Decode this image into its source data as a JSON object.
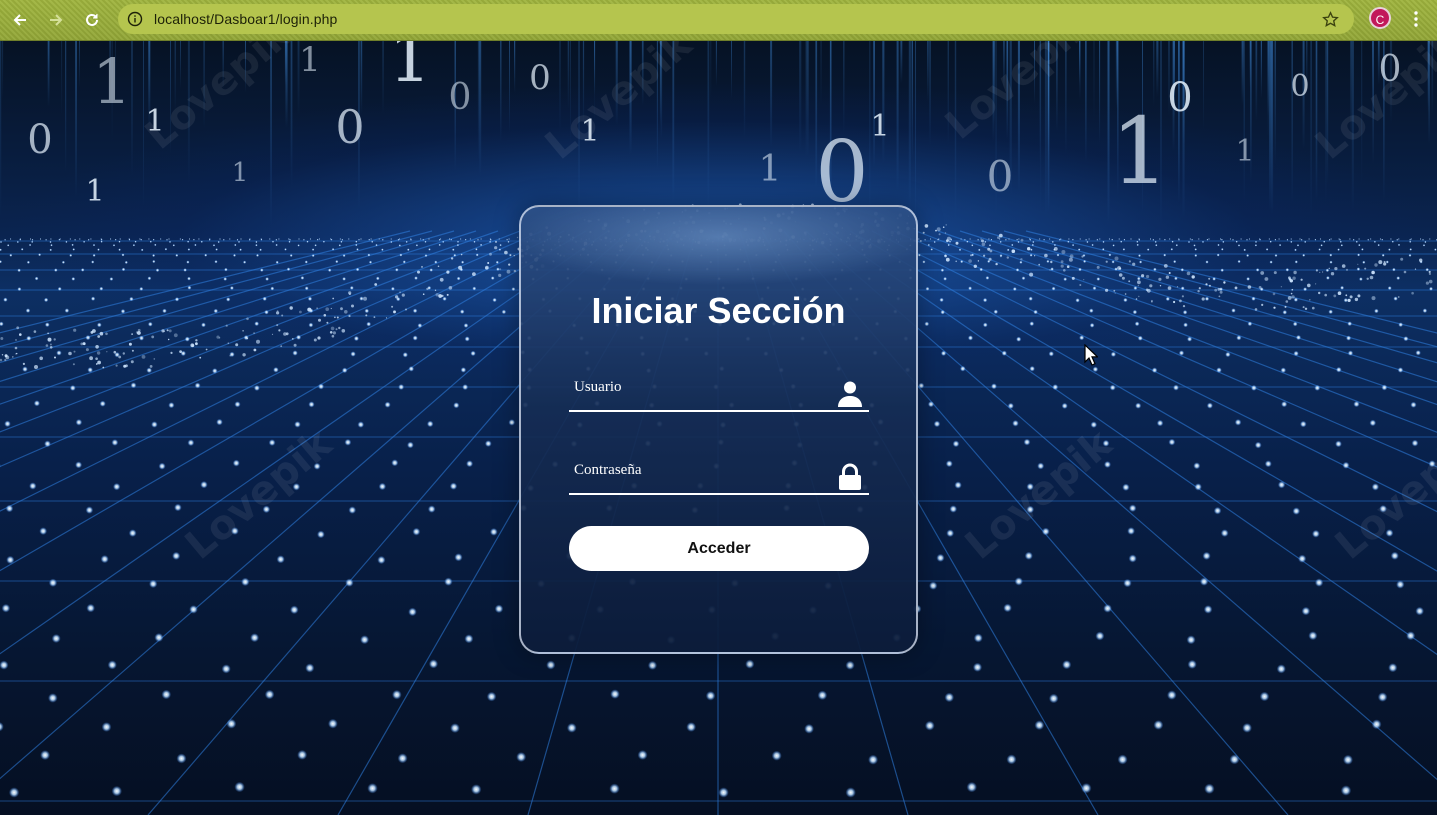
{
  "browser": {
    "url": "localhost/Dasboar1/login.php",
    "profile_initial": "C",
    "accent": "#9fb43e",
    "profile_color": "#c2185b"
  },
  "icons": {
    "back": "arrow-left-icon",
    "forward": "arrow-right-icon",
    "reload": "reload-icon",
    "site_info": "info-icon",
    "bookmark": "star-icon",
    "menu": "kebab-menu-icon",
    "username": "user-icon",
    "password": "lock-icon"
  },
  "login": {
    "title": "Iniciar Sección",
    "username_label": "Usuario",
    "password_label": "Contraseña",
    "submit_label": "Acceder"
  },
  "background": {
    "binary_digits": [
      "1",
      "0",
      "1",
      "1",
      "0",
      "1",
      "0",
      "0",
      "1",
      "1",
      "0",
      "1",
      "0",
      "1",
      "0",
      "1",
      "0",
      "1",
      "1",
      "0"
    ],
    "watermark": "Lovepik"
  }
}
